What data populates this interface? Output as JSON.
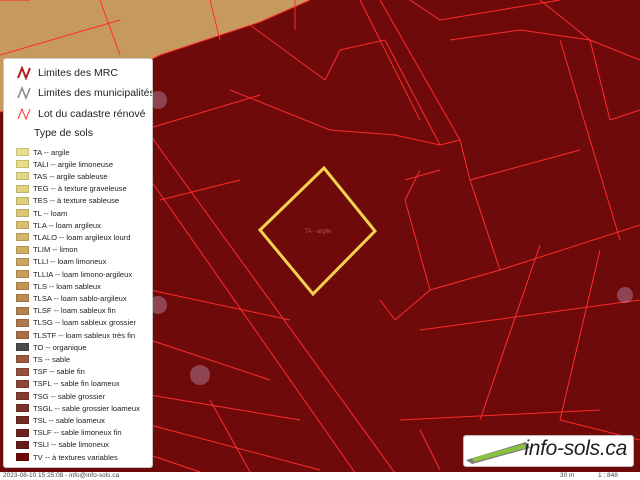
{
  "colors": {
    "background_soil": "#6f0a0a",
    "tan_soil": "#c69a5e",
    "lot_line": "#ff2b2b",
    "selection": "#f3d250",
    "mrc_line": "#b71c1c",
    "muni_line": "#8c8c8c"
  },
  "map": {
    "selection_label": "TA - argile"
  },
  "legend": {
    "lines": [
      {
        "label": "Limites des MRC",
        "color": "#b71c1c",
        "icon": "mrc-boundary-icon"
      },
      {
        "label": "Limites des municipalités",
        "color": "#8c8c8c",
        "icon": "municipality-boundary-icon"
      },
      {
        "label": "Lot du cadastre rénové",
        "color": "#ff2b2b",
        "icon": "cadastre-lot-icon"
      }
    ],
    "soil_title": "Type de sols",
    "soils": [
      {
        "code": "TA -- argile",
        "color": "#eadf8a"
      },
      {
        "code": "TALI -- argile limoneuse",
        "color": "#e8dc86"
      },
      {
        "code": "TAS -- argile sableuse",
        "color": "#e5d782"
      },
      {
        "code": "TEG -- à texture graveleuse",
        "color": "#e2d27f"
      },
      {
        "code": "TES -- à texture sableuse",
        "color": "#dfcd7a"
      },
      {
        "code": "TL -- loam",
        "color": "#dcc676"
      },
      {
        "code": "TLA -- loam argileux",
        "color": "#d8bf70"
      },
      {
        "code": "TLALO -- loam argileux lourd",
        "color": "#d4b76a"
      },
      {
        "code": "TLIM -- limon",
        "color": "#d0ae64"
      },
      {
        "code": "TLLI -- loam limoneux",
        "color": "#cba55f"
      },
      {
        "code": "TLLIA -- loam limono-argileux",
        "color": "#c79d5a"
      },
      {
        "code": "TLS -- loam sableux",
        "color": "#c29456"
      },
      {
        "code": "TLSA -- loam sablo-argileux",
        "color": "#bc8a52"
      },
      {
        "code": "TLSF -- loam sableux fin",
        "color": "#b6814e"
      },
      {
        "code": "TLSG -- loam sableux grossier",
        "color": "#b0784a"
      },
      {
        "code": "TLSTF -- loam sableux très fin",
        "color": "#a96f46"
      },
      {
        "code": "TO -- organique",
        "color": "#4a4a4a"
      },
      {
        "code": "TS -- sable",
        "color": "#9c5a3f"
      },
      {
        "code": "TSF -- sable fin",
        "color": "#94503a"
      },
      {
        "code": "TSFL -- sable fin loameux",
        "color": "#8c4635"
      },
      {
        "code": "TSG -- sable grossier",
        "color": "#843c30"
      },
      {
        "code": "TSGL -- sable grossier loameux",
        "color": "#7c332b"
      },
      {
        "code": "TSL -- sable loameux",
        "color": "#742a25"
      },
      {
        "code": "TSLF -- sable limoneux fin",
        "color": "#6c2220"
      },
      {
        "code": "TSLI -- sable limoneux",
        "color": "#641a1b"
      },
      {
        "code": "TV -- à textures variables",
        "color": "#6f0a0a"
      }
    ]
  },
  "logo": {
    "text": "info-sols.ca"
  },
  "footer": {
    "left_text": "2023-08-10 15:25:08 - info@info-sols.ca",
    "right_text": "30 m",
    "scale_text": "1 : 848"
  }
}
